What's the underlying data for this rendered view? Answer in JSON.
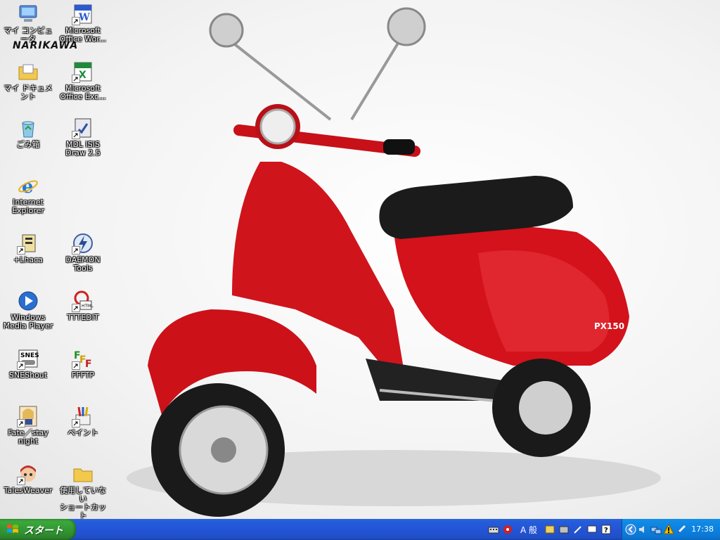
{
  "desktop": {
    "logo_text": "NARIKAWA",
    "icons_left": [
      {
        "label": "マイ コンピュータ",
        "icon": "my-computer-icon"
      },
      {
        "label": "マイ ドキュメント",
        "icon": "my-documents-icon"
      },
      {
        "label": "ごみ箱",
        "icon": "recycle-bin-icon"
      },
      {
        "label": "Internet\nExplorer",
        "icon": "internet-explorer-icon"
      },
      {
        "label": "+Lhaca",
        "icon": "lhaca-icon"
      },
      {
        "label": "Windows\nMedia Player",
        "icon": "media-player-icon"
      },
      {
        "label": "SNEShout",
        "icon": "sneshout-icon"
      },
      {
        "label": "Fate／stay\nnight",
        "icon": "fate-stay-night-icon"
      },
      {
        "label": "TalesWeaver",
        "icon": "talesweaver-icon"
      }
    ],
    "icons_right": [
      {
        "label": "Microsoft\nOffice Wor...",
        "icon": "word-icon"
      },
      {
        "label": "Microsoft\nOffice Exc...",
        "icon": "excel-icon"
      },
      {
        "label": "MDL ISIS\nDraw 2.5",
        "icon": "isis-draw-icon"
      },
      {
        "label": "DAEMON\nTools",
        "icon": "daemon-tools-icon"
      },
      {
        "label": "TTTEDIT",
        "icon": "tttedit-icon"
      },
      {
        "label": "FFFTP",
        "icon": "ffftp-icon"
      },
      {
        "label": "ペイント",
        "icon": "paint-icon"
      },
      {
        "label": "使用していない\nショートカット",
        "icon": "folder-icon"
      }
    ],
    "wallpaper_text": "PX150"
  },
  "taskbar": {
    "start_label": "スタート",
    "ime_text": "A 般",
    "clock": "17:38"
  },
  "colors": {
    "taskbar_blue": "#245edb",
    "start_green": "#3aa83a",
    "tray_blue": "#0f8ae6",
    "scooter_red": "#d0141c"
  }
}
